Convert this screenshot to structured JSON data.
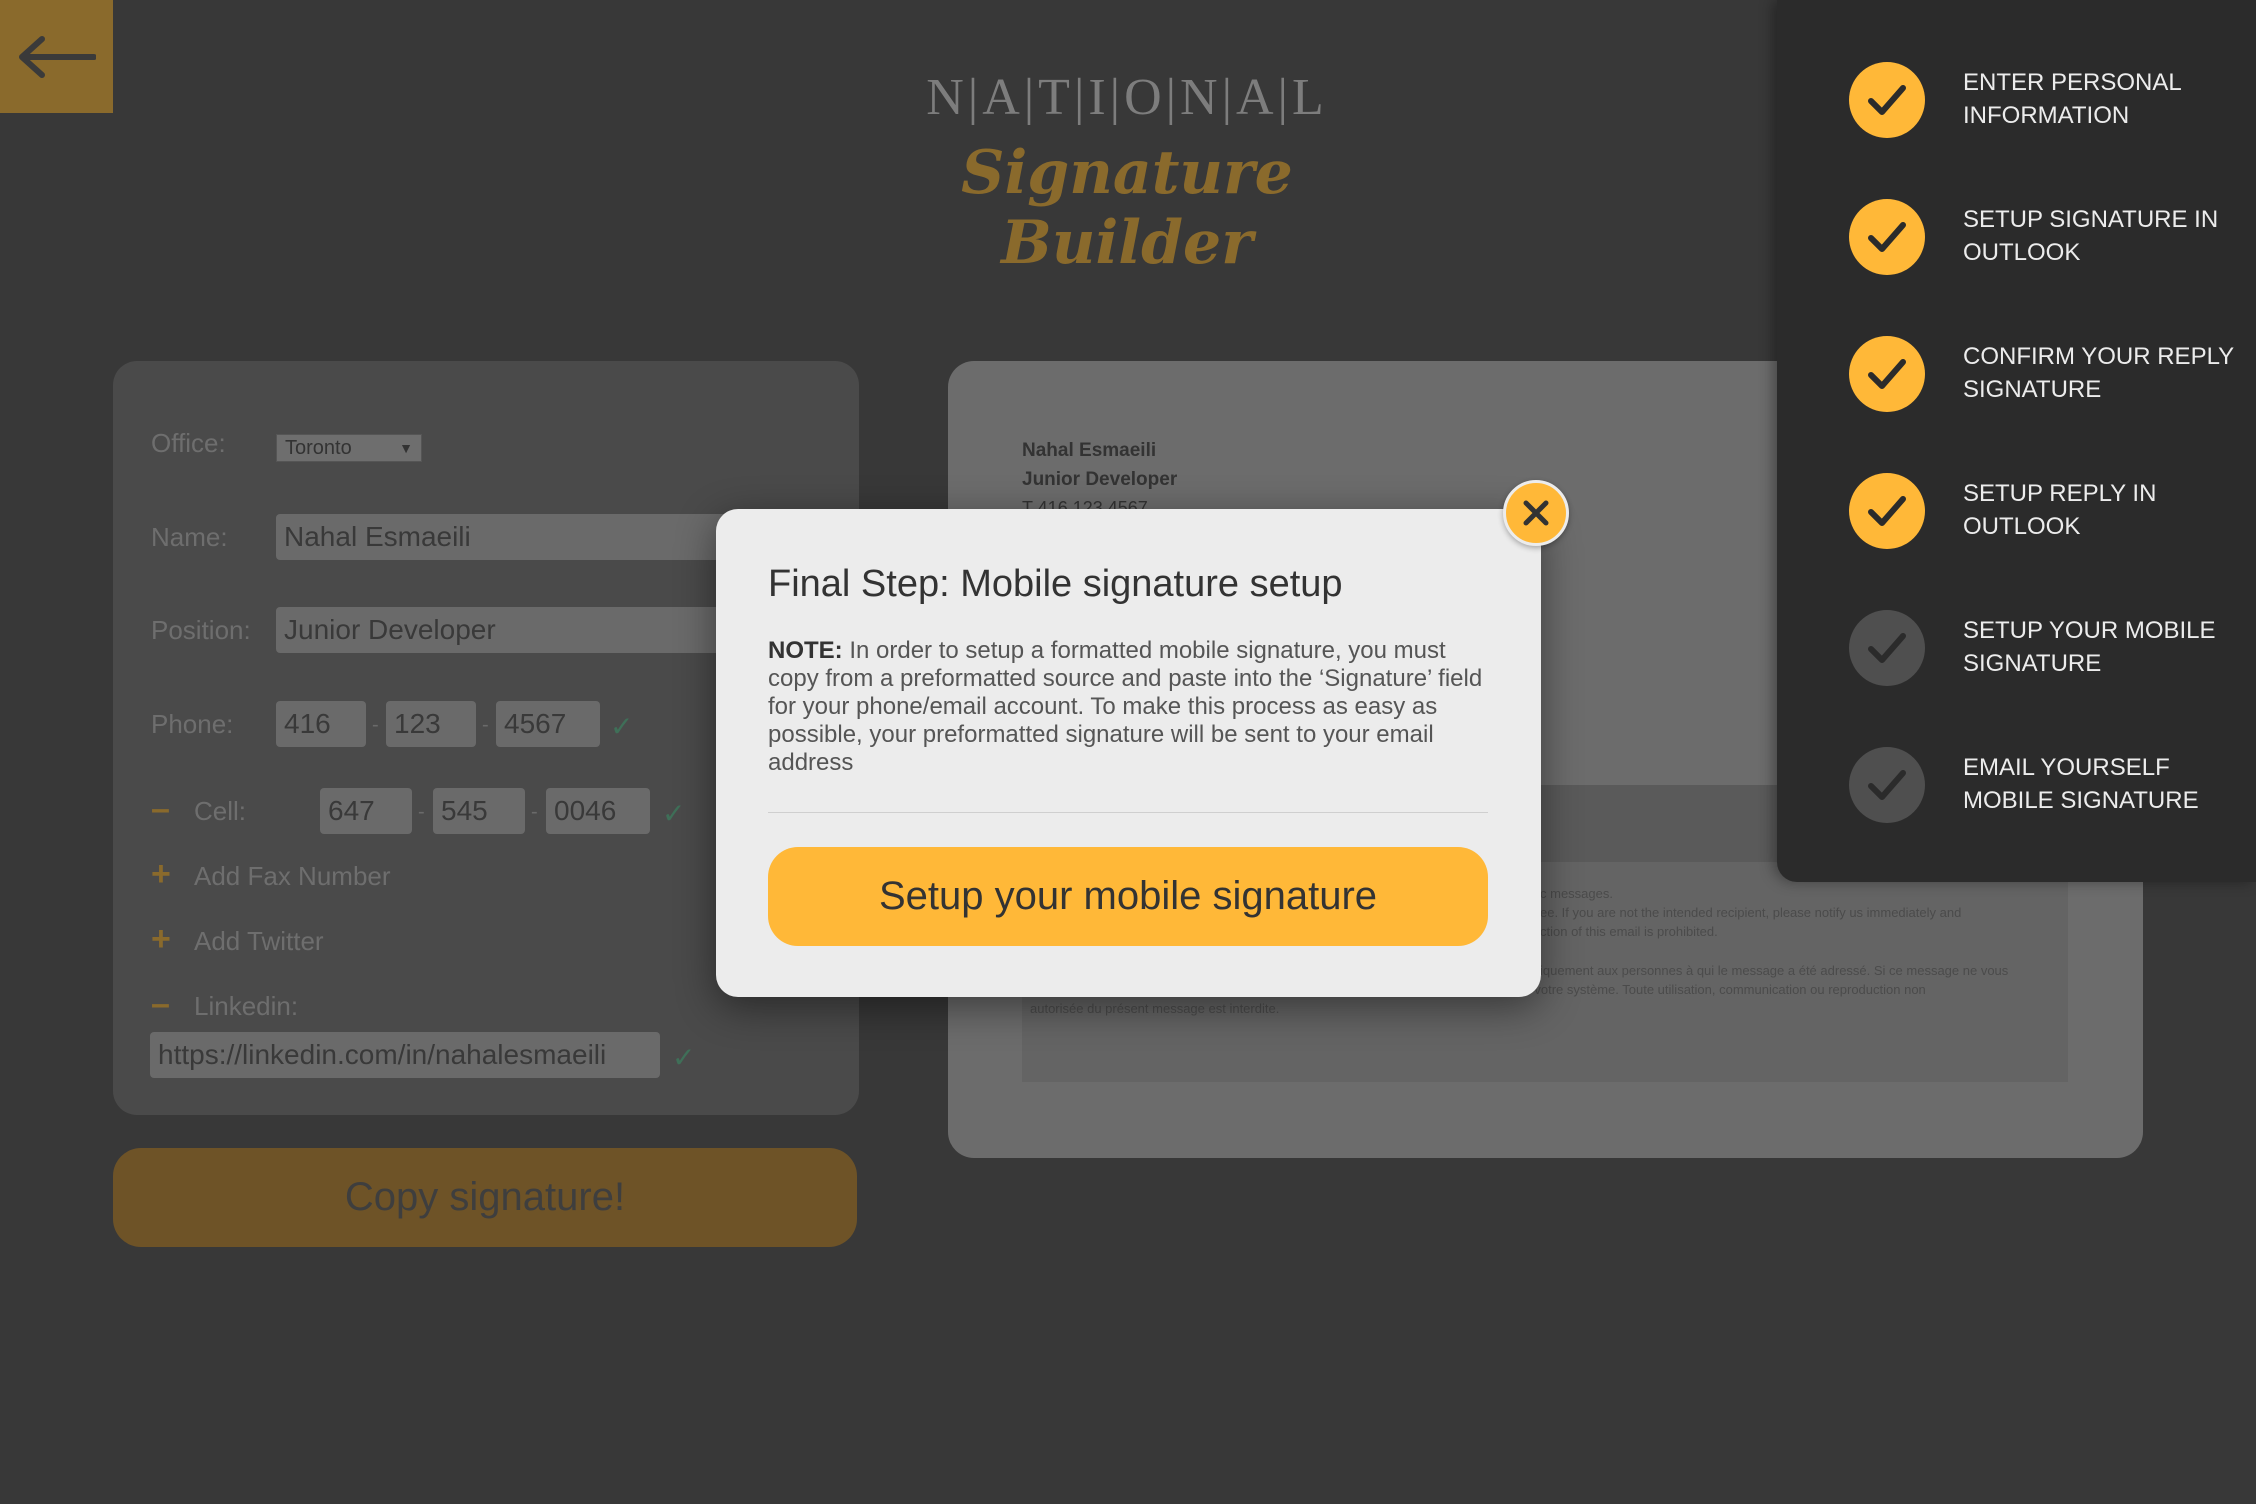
{
  "logo": {
    "top": "N|A|T|I|O|N|A|L",
    "bottom": "Signature Builder"
  },
  "form": {
    "office_label": "Office:",
    "office_value": "Toronto",
    "name_label": "Name:",
    "name_value": "Nahal Esmaeili",
    "position_label": "Position:",
    "position_value": "Junior Developer",
    "phone_label": "Phone:",
    "phone": [
      "416",
      "123",
      "4567"
    ],
    "cell_label": "Cell:",
    "cell": [
      "647",
      "545",
      "0046"
    ],
    "add_fax": "Add Fax Number",
    "add_twitter": "Add Twitter",
    "linkedin_label": "Linkedin:",
    "linkedin_value": "https://linkedin.com/in/nahalesmaeili",
    "dash": "-",
    "check": "✓",
    "plus": "+",
    "minus": "–",
    "copy_button": "Copy signature!"
  },
  "preview": {
    "name": "Nahal Esmaeili",
    "title": "Junior Developer",
    "phone_partial": "T 416 123 4567",
    "disclaimer_en": [
      "c messages.",
      "ee. If you are not the intended recipient, please notify us immediately and",
      "ction of this email is prohibited."
    ],
    "disclaimer_fr": [
      "iquement aux personnes à qui le message a été adressé. Si ce message ne vous",
      "était pas destiné, veuillez nous prévenir immédiatement puis supprimer ce message de votre système. Toute utilisation, communication ou reproduction non",
      "autorisée du présent message est interdite."
    ]
  },
  "steps": [
    {
      "label": "Enter personal information",
      "done": true
    },
    {
      "label": "Setup signature in Outlook",
      "done": true
    },
    {
      "label": "Confirm your reply signature",
      "done": true
    },
    {
      "label": "Setup reply in Outlook",
      "done": true
    },
    {
      "label": "Setup your mobile signature",
      "done": false
    },
    {
      "label": "Email yourself mobile signature",
      "done": false
    }
  ],
  "modal": {
    "title": "Final Step: Mobile signature setup",
    "note_label": "NOTE:",
    "note_text": " In order to setup a formatted mobile signature, you must copy from a preformatted source and paste into the ‘Signature’ field for your phone/email account. To make this process as easy as possible, your preformatted signature will be sent to your email address",
    "button": "Setup your mobile signature"
  },
  "colors": {
    "accent": "#ffb838",
    "background": "#383838",
    "panel": "#2b2b2b"
  }
}
